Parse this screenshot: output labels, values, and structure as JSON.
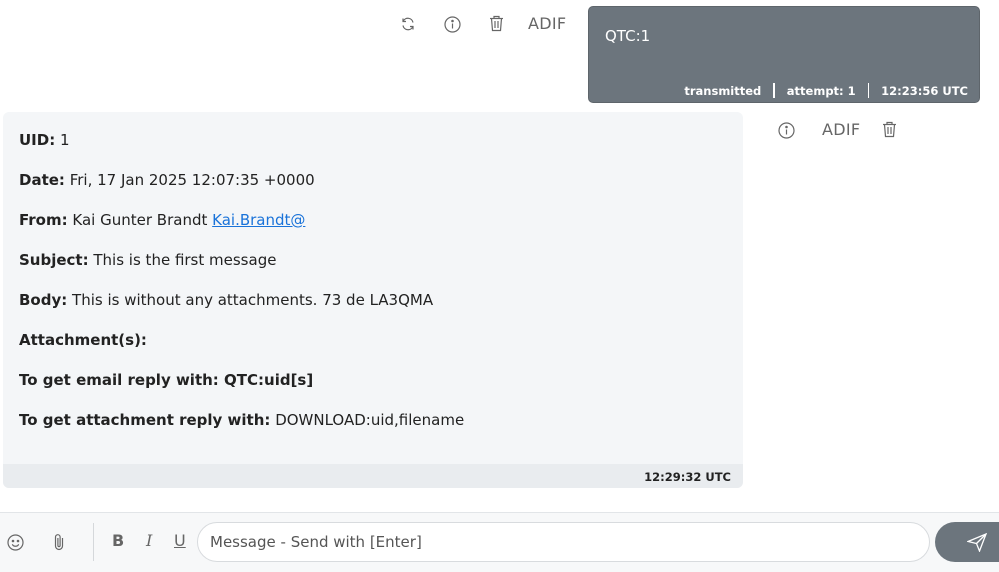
{
  "outgoing": {
    "actions": {
      "adif_label": "ADIF"
    },
    "text": "QTC:1",
    "status": "transmitted",
    "attempt": "attempt: 1",
    "time": "12:23:56 UTC"
  },
  "incoming": {
    "actions": {
      "adif_label": "ADIF"
    },
    "uid_label": "UID:",
    "uid_value": "1",
    "date_label": "Date:",
    "date_value": "Fri, 17 Jan 2025 12:07:35 +0000",
    "from_label": "From:",
    "from_name": "Kai Gunter Brandt",
    "from_email": "Kai.Brandt@",
    "subject_label": "Subject:",
    "subject_value": "This is the first message",
    "body_label": "Body:",
    "body_value": "This is without any attachments. 73 de LA3QMA",
    "attachments_label": "Attachment(s):",
    "email_reply_label": "To get email reply with: QTC:uid[s]",
    "attachment_reply_label": "To get attachment reply with:",
    "attachment_reply_value": "DOWNLOAD:uid,filename",
    "time": "12:29:32 UTC"
  },
  "composer": {
    "bold_label": "B",
    "italic_label": "I",
    "underline_label": "U",
    "placeholder": "Message - Send with [Enter]"
  },
  "icons": {
    "retry": "refresh-icon",
    "info": "info-icon",
    "delete": "trash-icon",
    "emoji": "smiley-icon",
    "attach": "paperclip-icon",
    "send": "paper-plane-icon"
  }
}
